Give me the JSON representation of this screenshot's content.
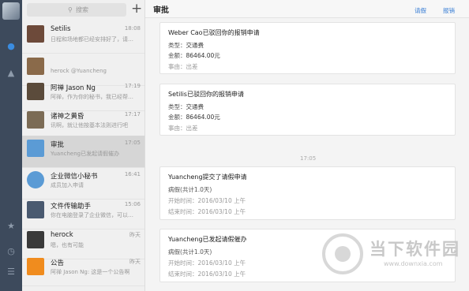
{
  "search": {
    "placeholder": "搜索"
  },
  "conversations": [
    {
      "name": "Setilis",
      "time": "18:08",
      "preview": "日程和场地都已经安排好了，请…",
      "avatar_color": "#6d4a3a"
    },
    {
      "name": "",
      "time": "",
      "preview": "herock  @Yuancheng",
      "avatar_color": "#8a6a4a"
    },
    {
      "name": "阿禅 Jason Ng",
      "time": "17:19",
      "preview": "阿禅，作为你的秘书，我已经帮…",
      "avatar_color": "#5b4b3b"
    },
    {
      "name": "诸神之黄昏",
      "time": "17:17",
      "preview": "讯啊，就让他按基本法则进行吧",
      "avatar_color": "#7b6b55"
    },
    {
      "name": "审批",
      "time": "17:05",
      "preview": "Yuancheng已发起请假催办",
      "avatar_color": "#5b9bd5"
    },
    {
      "name": "企业微信小秘书",
      "time": "16:41",
      "preview": "成员加入申请",
      "avatar_color": "#5b9bd5"
    },
    {
      "name": "文件传输助手",
      "time": "15:06",
      "preview": "你在电脑登录了企业微信，可以…",
      "avatar_color": "#4a5a70"
    },
    {
      "name": "herock",
      "time": "昨天",
      "preview": "嗯，也有可能",
      "avatar_color": "#3a3a3a"
    },
    {
      "name": "公告",
      "time": "昨天",
      "preview": "阿禅 Jason Ng: 这是一个公告啊",
      "avatar_color": "#f08c1e"
    }
  ],
  "header": {
    "title": "审批",
    "link1": "请假",
    "link2": "报销"
  },
  "cards": [
    {
      "title": "Weber Cao已驳回你的报销申请",
      "rows": [
        {
          "k": "类型：",
          "v": "交通费",
          "muted": false
        },
        {
          "k": "金额：",
          "v": "86464.00元",
          "muted": false
        },
        {
          "k": "事由：",
          "v": "出差",
          "muted": true
        }
      ]
    },
    {
      "title": "Setilis已驳回你的报销申请",
      "rows": [
        {
          "k": "类型：",
          "v": "交通费",
          "muted": false
        },
        {
          "k": "金额：",
          "v": "86464.00元",
          "muted": false
        },
        {
          "k": "事由：",
          "v": "出差",
          "muted": true
        }
      ]
    },
    {
      "title": "Yuancheng提交了请假申请",
      "rows": [
        {
          "k": "病假(共计1.0天)",
          "v": "",
          "muted": false
        },
        {
          "k": "开始时间：",
          "v": "2016/03/10 上午",
          "muted": true
        },
        {
          "k": "结束时间：",
          "v": "2016/03/10 上午",
          "muted": true
        }
      ]
    },
    {
      "title": "Yuancheng已发起请假催办",
      "rows": [
        {
          "k": "病假(共计1.0天)",
          "v": "",
          "muted": false
        },
        {
          "k": "开始时间：",
          "v": "2016/03/10 上午",
          "muted": true
        },
        {
          "k": "结束时间：",
          "v": "2016/03/10 上午",
          "muted": true
        }
      ]
    }
  ],
  "divider_time": "17:05",
  "watermark": {
    "cn": "当下软件园",
    "url": "www.downxia.com"
  }
}
